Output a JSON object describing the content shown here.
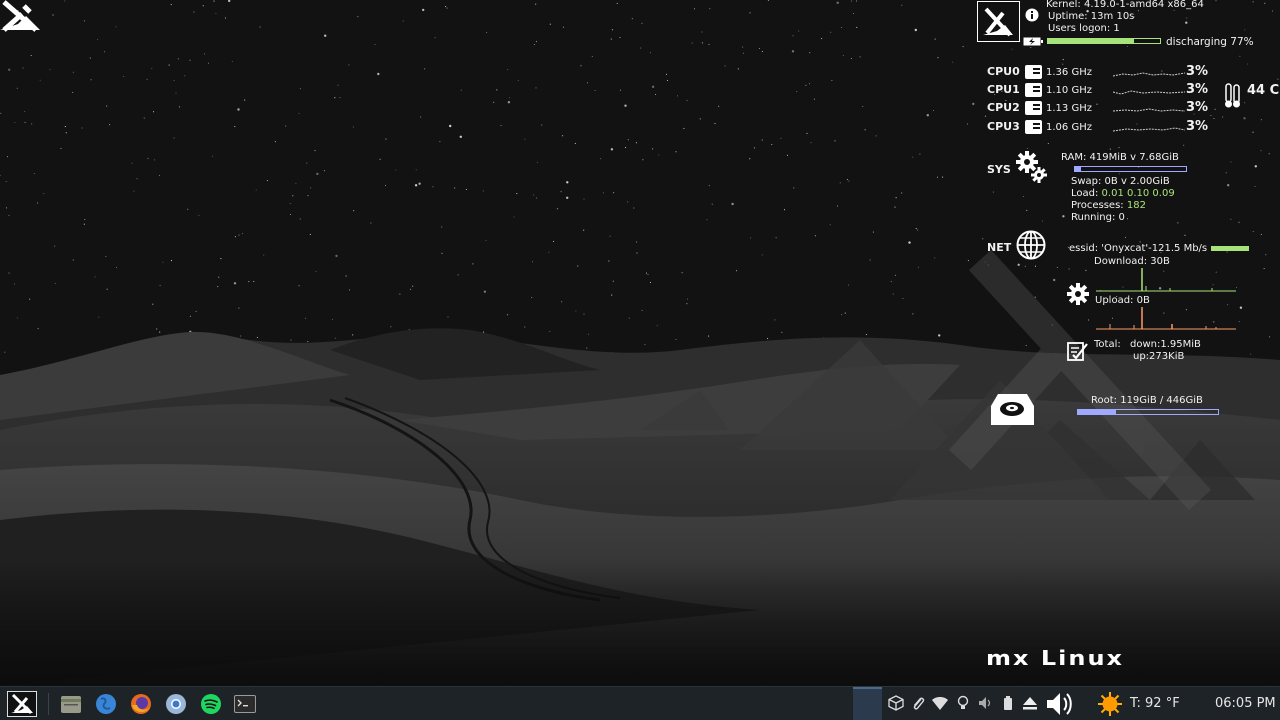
{
  "sysinfo": {
    "kernel": "Kernel: 4.19.0-1-amd64 x86_64",
    "uptime": "Uptime: 13m 10s",
    "users": "Users logon: 1",
    "battery_text": "discharging 77%",
    "battery_level": 0.77
  },
  "cpu": {
    "temperature": "44 C",
    "cores": [
      {
        "label": "CPU0",
        "freq": "1.36 GHz",
        "usage": "3%"
      },
      {
        "label": "CPU1",
        "freq": "1.10 GHz",
        "usage": "3%"
      },
      {
        "label": "CPU2",
        "freq": "1.13 GHz",
        "usage": "3%"
      },
      {
        "label": "CPU3",
        "freq": "1.06 GHz",
        "usage": "3%"
      }
    ]
  },
  "sys": {
    "label": "SYS",
    "ram": "RAM: 419MiB v 7.68GiB",
    "ram_level": 0.05,
    "swap": "Swap: 0B   v 2.00GiB",
    "load_label": "Load: ",
    "load_values": "0.01 0.10 0.09",
    "processes_label": "Processes: ",
    "processes_value": "182",
    "running": "Running: 0"
  },
  "net": {
    "label": "NET",
    "essid": "essid: 'Onyxcat'-121.5 Mb/s",
    "signal_level": 1.0,
    "download": "Download: 30B",
    "upload": "Upload: 0B",
    "total_label": "Total:",
    "total_down": "down:1.95MiB",
    "total_up": "up:273KiB"
  },
  "disk": {
    "root": "Root: 119GiB / 446GiB",
    "root_level": 0.27
  },
  "branding": {
    "text": "mx Linux"
  },
  "taskbar": {
    "weather": "T: 92 °F",
    "clock": "06:05 PM"
  },
  "colors": {
    "accent_green": "#a8e27a",
    "bar_blue": "#9fa9ff",
    "upload_orange": "#ff9a66",
    "taskbar_bg": "#1e2328"
  }
}
